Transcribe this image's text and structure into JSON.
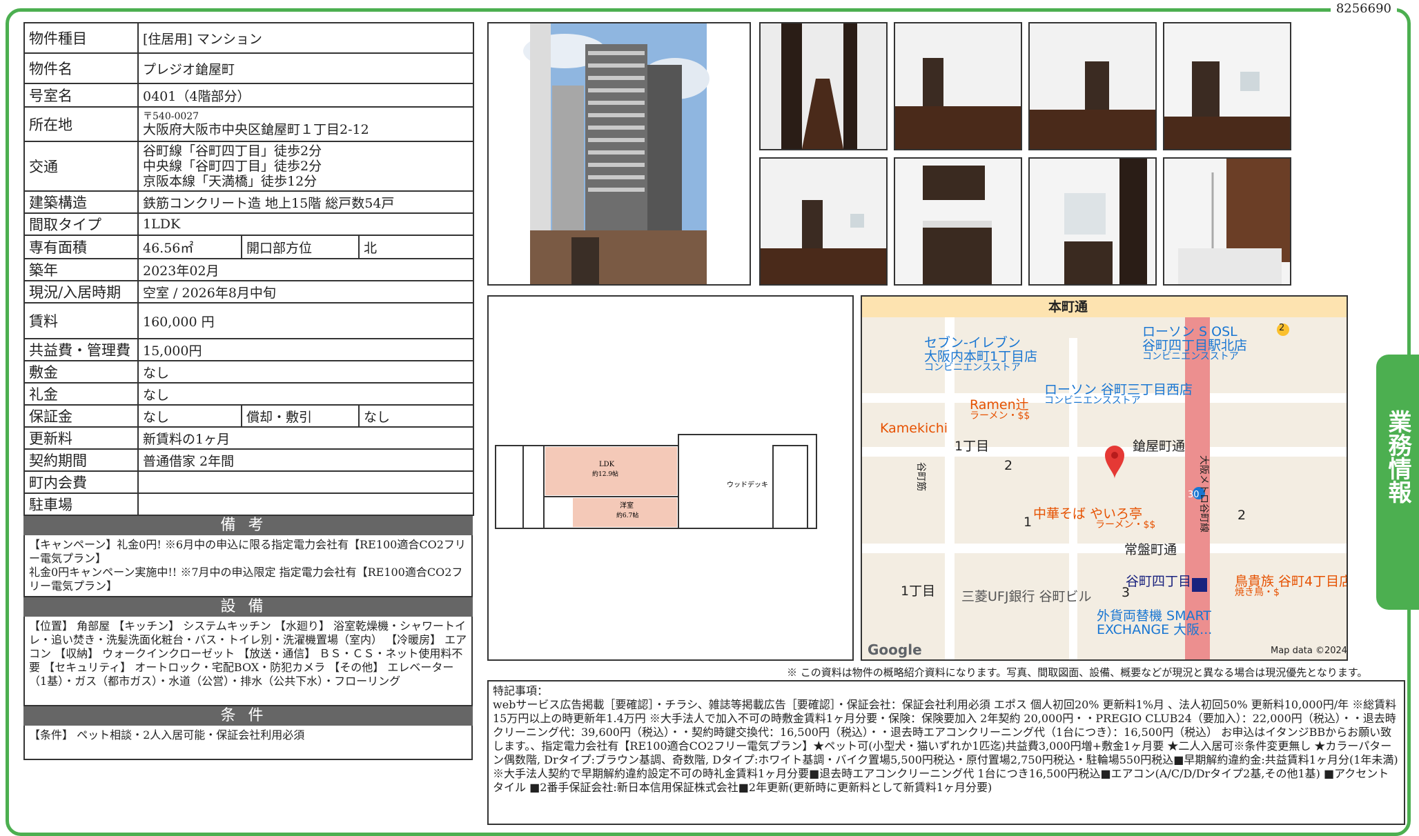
{
  "doc_id": "8256690",
  "spec": {
    "type_label": "物件種目",
    "type_value": "[住居用] マンション",
    "name_label": "物件名",
    "name_value": "プレジオ鎗屋町",
    "room_label": "号室名",
    "room_value": "0401（4階部分）",
    "address_label": "所在地",
    "address_zip": "〒540-0027",
    "address_value": "大阪府大阪市中央区鎗屋町１丁目2-12",
    "access_label": "交通",
    "access": [
      "谷町線「谷町四丁目」徒歩2分",
      "中央線「谷町四丁目」徒歩2分",
      "京阪本線「天満橋」徒歩12分"
    ],
    "structure_label": "建築構造",
    "structure_value": "鉄筋コンクリート造 地上15階 総戸数54戸",
    "layout_label": "間取タイプ",
    "layout_value": "1LDK",
    "area_label": "専有面積",
    "area_value": "46.56㎡",
    "direction_label": "開口部方位",
    "direction_value": "北",
    "built_label": "築年",
    "built_value": "2023年02月",
    "status_label": "現況/入居時期",
    "status_value": "空室 / 2026年8月中旬",
    "rent_label": "賃料",
    "rent_value": "160,000 円",
    "fee_label": "共益費・管理費",
    "fee_value": "15,000円",
    "deposit_label": "敷金",
    "deposit_value": "なし",
    "keymoney_label": "礼金",
    "keymoney_value": "なし",
    "guarantee_label": "保証金",
    "guarantee_value": "なし",
    "amort_label": "償却・敷引",
    "amort_value": "なし",
    "renewal_label": "更新料",
    "renewal_value": "新賃料の1ヶ月",
    "contract_label": "契約期間",
    "contract_value": "普通借家 2年間",
    "community_label": "町内会費",
    "community_value": "",
    "parking_label": "駐車場",
    "parking_value": ""
  },
  "remarks": {
    "title": "備考",
    "lines": [
      "【キャンペーン】礼金0円! ※6月中の申込に限る指定電力会社有【RE100適合CO2フリー電気プラン】",
      "礼金0円キャンペーン実施中!! ※7月中の申込限定 指定電力会社有【RE100適合CO2フリー電気プラン】"
    ]
  },
  "equipment": {
    "title": "設備",
    "text": "【位置】 角部屋 【キッチン】 システムキッチン 【水廻り】 浴室乾燥機・シャワートイレ・追い焚き・洗髪洗面化粧台・バス・トイレ別・洗濯機置場（室内） 【冷暖房】 エアコン 【収納】 ウォークインクローゼット 【放送・通信】 ＢＳ・ＣＳ・ネット使用料不要 【セキュリティ】 オートロック・宅配BOX・防犯カメラ 【その他】 エレベーター（1基）・ガス（都市ガス）・水道（公営）・排水（公共下水）・フローリング"
  },
  "conditions": {
    "title": "条件",
    "text": "【条件】 ペット相談・2人入居可能・保証会社利用必須"
  },
  "floorplan": {
    "ldk": "LDK",
    "ldk_size": "約12.9帖",
    "western": "洋室",
    "western_size": "約6.7帖",
    "deck": "ウッドデッキ"
  },
  "map": {
    "street_top": "本町通",
    "lawson1": "ローソン S OSL",
    "lawson1b": "谷町四丁目駅北店",
    "lawson1c": "コンビニエンスストア",
    "seven": "セブン-イレブン",
    "seven2": "大阪内本町1丁目店",
    "seven3": "コンビニエンスストア",
    "lawson2": "ローソン 谷町三丁目西店",
    "lawson2b": "コンビニエンスストア",
    "ramen": "Ramen辻",
    "ramen2": "ラーメン・$$",
    "kamekichi": "Kamekichi",
    "chome1": "1丁目",
    "n2": "2",
    "yariya": "鎗屋町通",
    "chuka": "中華そば やいろ亭",
    "chuka2": "ラーメン・$$",
    "n1": "1",
    "jobanmachi": "常盤町通",
    "tanimachi4": "谷町四丁目",
    "chome1b": "1丁目",
    "mufg": "三菱UFJ銀行 谷町ビル",
    "torikizoku": "鳥貴族 谷町4丁目店",
    "torikizoku2": "焼き鳥・$",
    "exchange": "外貨両替機 SMART",
    "exchange2": "EXCHANGE 大阪...",
    "n3": "3",
    "n2b": "2",
    "route30": "30",
    "route2": "2",
    "google": "Google",
    "mapdata": "Map data ©2024",
    "street_v": "大阪メトロ谷町線",
    "street_v2": "谷町筋"
  },
  "note": "※ この資料は物件の概略紹介資料になります。写真、間取図面、設備、概要などが現況と異なる場合は現況優先となります。",
  "special": {
    "title": "特記事項：",
    "text": "webサービス広告掲載［要確認］・チラシ、雑誌等掲載広告［要確認］・保証会社：保証会社利用必須 エポス 個人初回20% 更新料1%月 、法人初回50% 更新料10,000円/年 ※総賃料15万円以上の時更新年1.4万円 ※大手法人で加入不可の時敷金賃料1ヶ月分要・保険：保険要加入 2年契約 20,000円・・PREGIO CLUB24（要加入）：22,000円（税込）・・退去時クリーニング代：39,600円（税込）・・契約時鍵交換代：16,500円（税込）・・退去時エアコンクリーニング代（1台につき）：16,500円（税込） お申込はイタンジBBからお願い致します。、指定電力会社有【RE100適合CO2フリー電気プラン】★ペット可(小型犬・猫いずれか1匹迄)共益費3,000円増+敷金1ヶ月要 ★二人入居可※条件変更無し ★カラーパターン偶数階, Drタイプ:ブラウン基調、奇数階, Dタイプ:ホワイト基調・バイク置場5,500円税込・原付置場2,750円税込・駐輪場550円税込■早期解約違約金:共益賃料1ヶ月分(1年未満) ※大手法人契約で早期解約違約設定不可の時礼金賃料1ヶ月分要■退去時エアコンクリーニング代 1台につき16,500円税込■エアコン(A/C/D/Drタイプ2基,その他1基) ■アクセントタイル ■2番手保証会社:新日本信用保証株式会社■2年更新(更新時に更新料として新賃料1ヶ月分要)"
  },
  "side_tab": "業務情報"
}
